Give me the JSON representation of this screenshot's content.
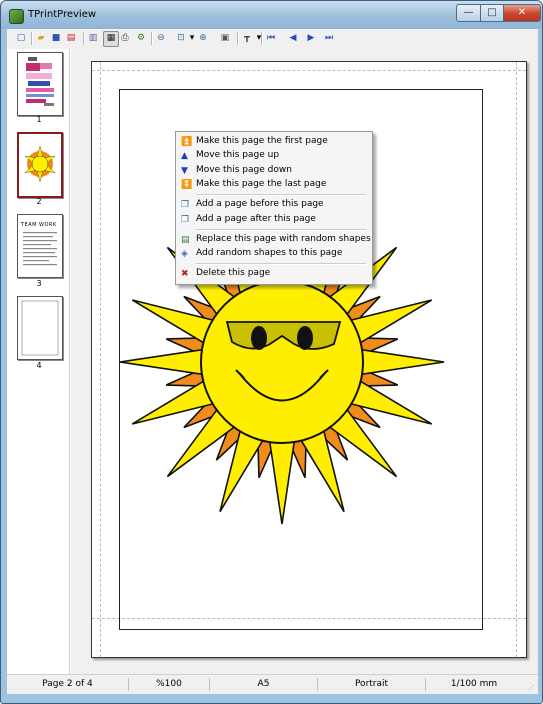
{
  "window": {
    "title": "TPrintPreview",
    "minimize": "—",
    "maximize": "□",
    "close": "✕"
  },
  "toolbar": {
    "buttons": [
      {
        "name": "new-icon",
        "glyph": "▢",
        "color": "#2e65b8"
      },
      {
        "name": "open-icon",
        "glyph": "▰",
        "color": "#d9a82a"
      },
      {
        "name": "save-icon",
        "glyph": "■",
        "color": "#2e57a8"
      },
      {
        "name": "pdf-icon",
        "glyph": "▤",
        "color": "#c02020"
      },
      {
        "name": "page-setup-icon",
        "glyph": "▥",
        "color": "#6f4ea3"
      },
      {
        "name": "print-preview-icon",
        "glyph": "▦",
        "color": "#222222"
      },
      {
        "name": "print-icon",
        "glyph": "⎙",
        "color": "#444444"
      },
      {
        "name": "print-setup-icon",
        "glyph": "⚙",
        "color": "#3b7a2a"
      },
      {
        "name": "zoom-out-icon",
        "glyph": "⊖",
        "color": "#3a6ea5"
      },
      {
        "name": "zoom-mode-icon",
        "glyph": "⊡",
        "color": "#3a6ea5"
      },
      {
        "name": "zoom-in-icon",
        "glyph": "⊕",
        "color": "#3a6ea5"
      },
      {
        "name": "fit-page-icon",
        "glyph": "▣",
        "color": "#555555"
      },
      {
        "name": "grid-icon",
        "glyph": "┳",
        "color": "#444444"
      },
      {
        "name": "first-page-icon",
        "glyph": "⏮",
        "color": "#1e4fc0"
      },
      {
        "name": "prev-page-icon",
        "glyph": "◀",
        "color": "#1e4fc0"
      },
      {
        "name": "next-page-icon",
        "glyph": "▶",
        "color": "#1e4fc0"
      },
      {
        "name": "last-page-icon",
        "glyph": "⏭",
        "color": "#1e4fc0"
      }
    ],
    "dropdown_arrow": "▾"
  },
  "thumbnails": [
    {
      "label": "1",
      "heading": ""
    },
    {
      "label": "2",
      "heading": ""
    },
    {
      "label": "3",
      "heading": "TEAM WORK"
    },
    {
      "label": "4",
      "heading": ""
    }
  ],
  "context_menu": {
    "items": [
      {
        "label": "Make this page the first page",
        "icon": "⏫",
        "color": "#1b3fb5"
      },
      {
        "label": "Move this page up",
        "icon": "▲",
        "color": "#1b3fb5"
      },
      {
        "label": "Move this page down",
        "icon": "▼",
        "color": "#1b3fb5"
      },
      {
        "label": "Make this page the last page",
        "icon": "⏬",
        "color": "#1b3fb5"
      },
      {
        "label": "Add a page before this page",
        "icon": "❐",
        "color": "#3a6ea5"
      },
      {
        "label": "Add a page after this page",
        "icon": "❐",
        "color": "#3a6ea5"
      },
      {
        "label": "Replace this page with random shapes",
        "icon": "▤",
        "color": "#3a7a3a"
      },
      {
        "label": "Add random shapes to this page",
        "icon": "◈",
        "color": "#3a6ea5"
      },
      {
        "label": "Delete this page",
        "icon": "✖",
        "color": "#c02020"
      }
    ]
  },
  "status": {
    "page": "Page 2 of 4",
    "zoom": "%100",
    "paper": "A5",
    "orientation": "Portrait",
    "units": "1/100 mm"
  },
  "colors": {
    "sun_fill": "#ffee00",
    "ray_back": "#f08c1a",
    "glasses": "#c8c000",
    "frame": "#9fc2df"
  }
}
